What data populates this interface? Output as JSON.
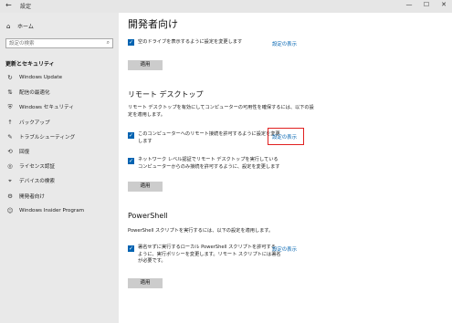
{
  "window": {
    "back": "←",
    "title": "設定",
    "controls": [
      "—",
      "☐",
      "✕"
    ]
  },
  "sidebar": {
    "home": "ホーム",
    "search_placeholder": "設定の検索",
    "section": "更新とセキュリティ",
    "items": [
      {
        "label": "Windows Update",
        "icon": "refresh-icon",
        "glyph": "↻"
      },
      {
        "label": "配信の最適化",
        "icon": "delivery-icon",
        "glyph": "⇅"
      },
      {
        "label": "Windows セキュリティ",
        "icon": "shield-icon",
        "glyph": "⛨"
      },
      {
        "label": "バックアップ",
        "icon": "backup-icon",
        "glyph": "↑"
      },
      {
        "label": "トラブルシューティング",
        "icon": "wrench-icon",
        "glyph": "🔧"
      },
      {
        "label": "回復",
        "icon": "recovery-icon",
        "glyph": "⟲"
      },
      {
        "label": "ライセンス認証",
        "icon": "license-icon",
        "glyph": "◎"
      },
      {
        "label": "デバイスの検索",
        "icon": "find-device-icon",
        "glyph": "⌖"
      },
      {
        "label": "開発者向け",
        "icon": "developer-icon",
        "glyph": "⚙"
      },
      {
        "label": "Windows Insider Program",
        "icon": "insider-icon",
        "glyph": "☺"
      }
    ]
  },
  "main": {
    "title": "開発者向け",
    "top_option": {
      "label": "空のドライブを表示するように設定を変更します",
      "link": "設定の表示",
      "apply": "適用"
    },
    "remote": {
      "heading": "リモート デスクトップ",
      "desc_1": "リモート デスクトップを有効にしてコンピューターの可用性を確保するには、以下の設",
      "desc_2": "定を適用します。",
      "option1_1": "このコンピューターへのリモート接続を許可するように設定を変更",
      "option1_2": "します",
      "option1_link": "設定の表示",
      "option2_1": "ネットワーク レベル認証でリモート デスクトップを実行している",
      "option2_2": "コンピューターからのみ接続を許可するように、設定を変更します",
      "apply": "適用"
    },
    "powershell": {
      "heading": "PowerShell",
      "desc": "PowerShell スクリプトを実行するには、以下の設定を適用します。",
      "option_1": "署名せずに実行するローカル PowerShell スクリプトを許可する",
      "option_2": "ように、実行ポリシーを変更します。リモート スクリプトには署名",
      "option_3": "が必要です。",
      "link": "設定の表示",
      "apply": "適用"
    }
  }
}
